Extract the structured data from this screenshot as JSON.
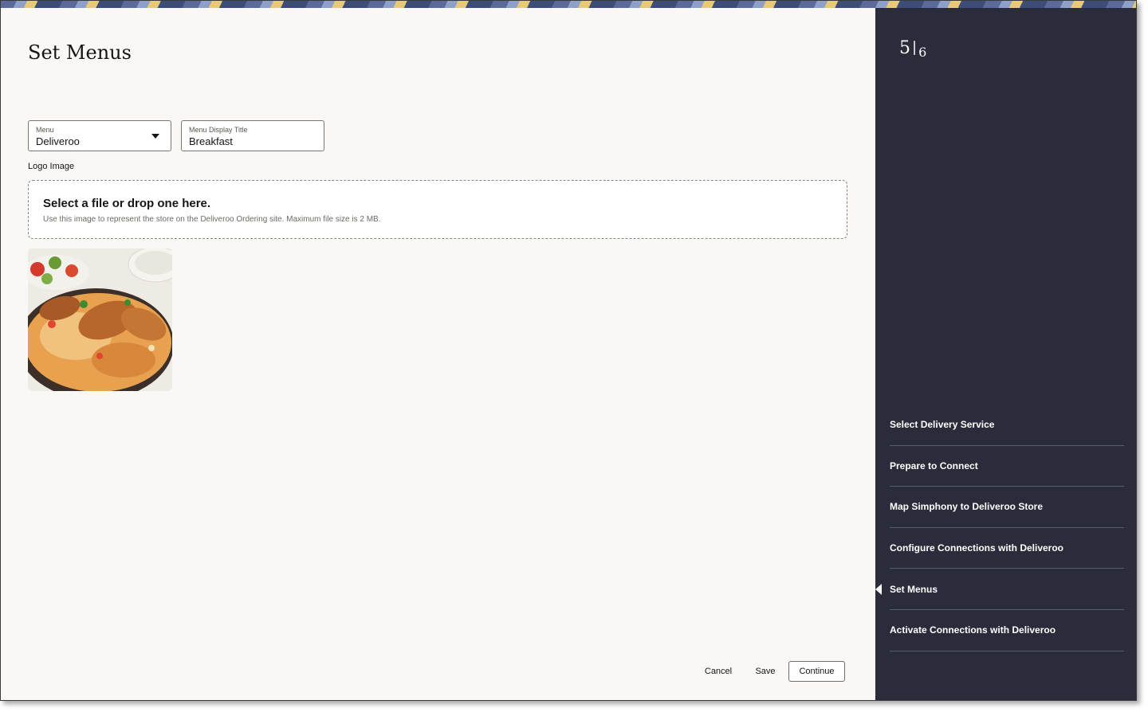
{
  "page": {
    "title": "Set Menus"
  },
  "form": {
    "menu": {
      "label": "Menu",
      "value": "Deliveroo"
    },
    "display_title": {
      "label": "Menu Display Title",
      "value": "Breakfast"
    },
    "logo_label": "Logo Image",
    "dropzone": {
      "title": "Select a file or drop one here.",
      "hint": "Use this image to represent the store on the Deliveroo Ordering site. Maximum file size is 2 MB."
    }
  },
  "footer": {
    "cancel_label": "Cancel",
    "save_label": "Save",
    "continue_label": "Continue"
  },
  "sidebar": {
    "step_current": "5",
    "step_total": "6",
    "steps": [
      {
        "label": "Select Delivery Service"
      },
      {
        "label": "Prepare to Connect"
      },
      {
        "label": "Map Simphony to Deliveroo Store"
      },
      {
        "label": "Configure Connections with Deliveroo"
      },
      {
        "label": "Set Menus"
      },
      {
        "label": "Activate Connections with Deliveroo"
      }
    ]
  },
  "colors": {
    "sidebar_bg": "#2a2c3b",
    "page_bg": "#f9f8f6"
  }
}
